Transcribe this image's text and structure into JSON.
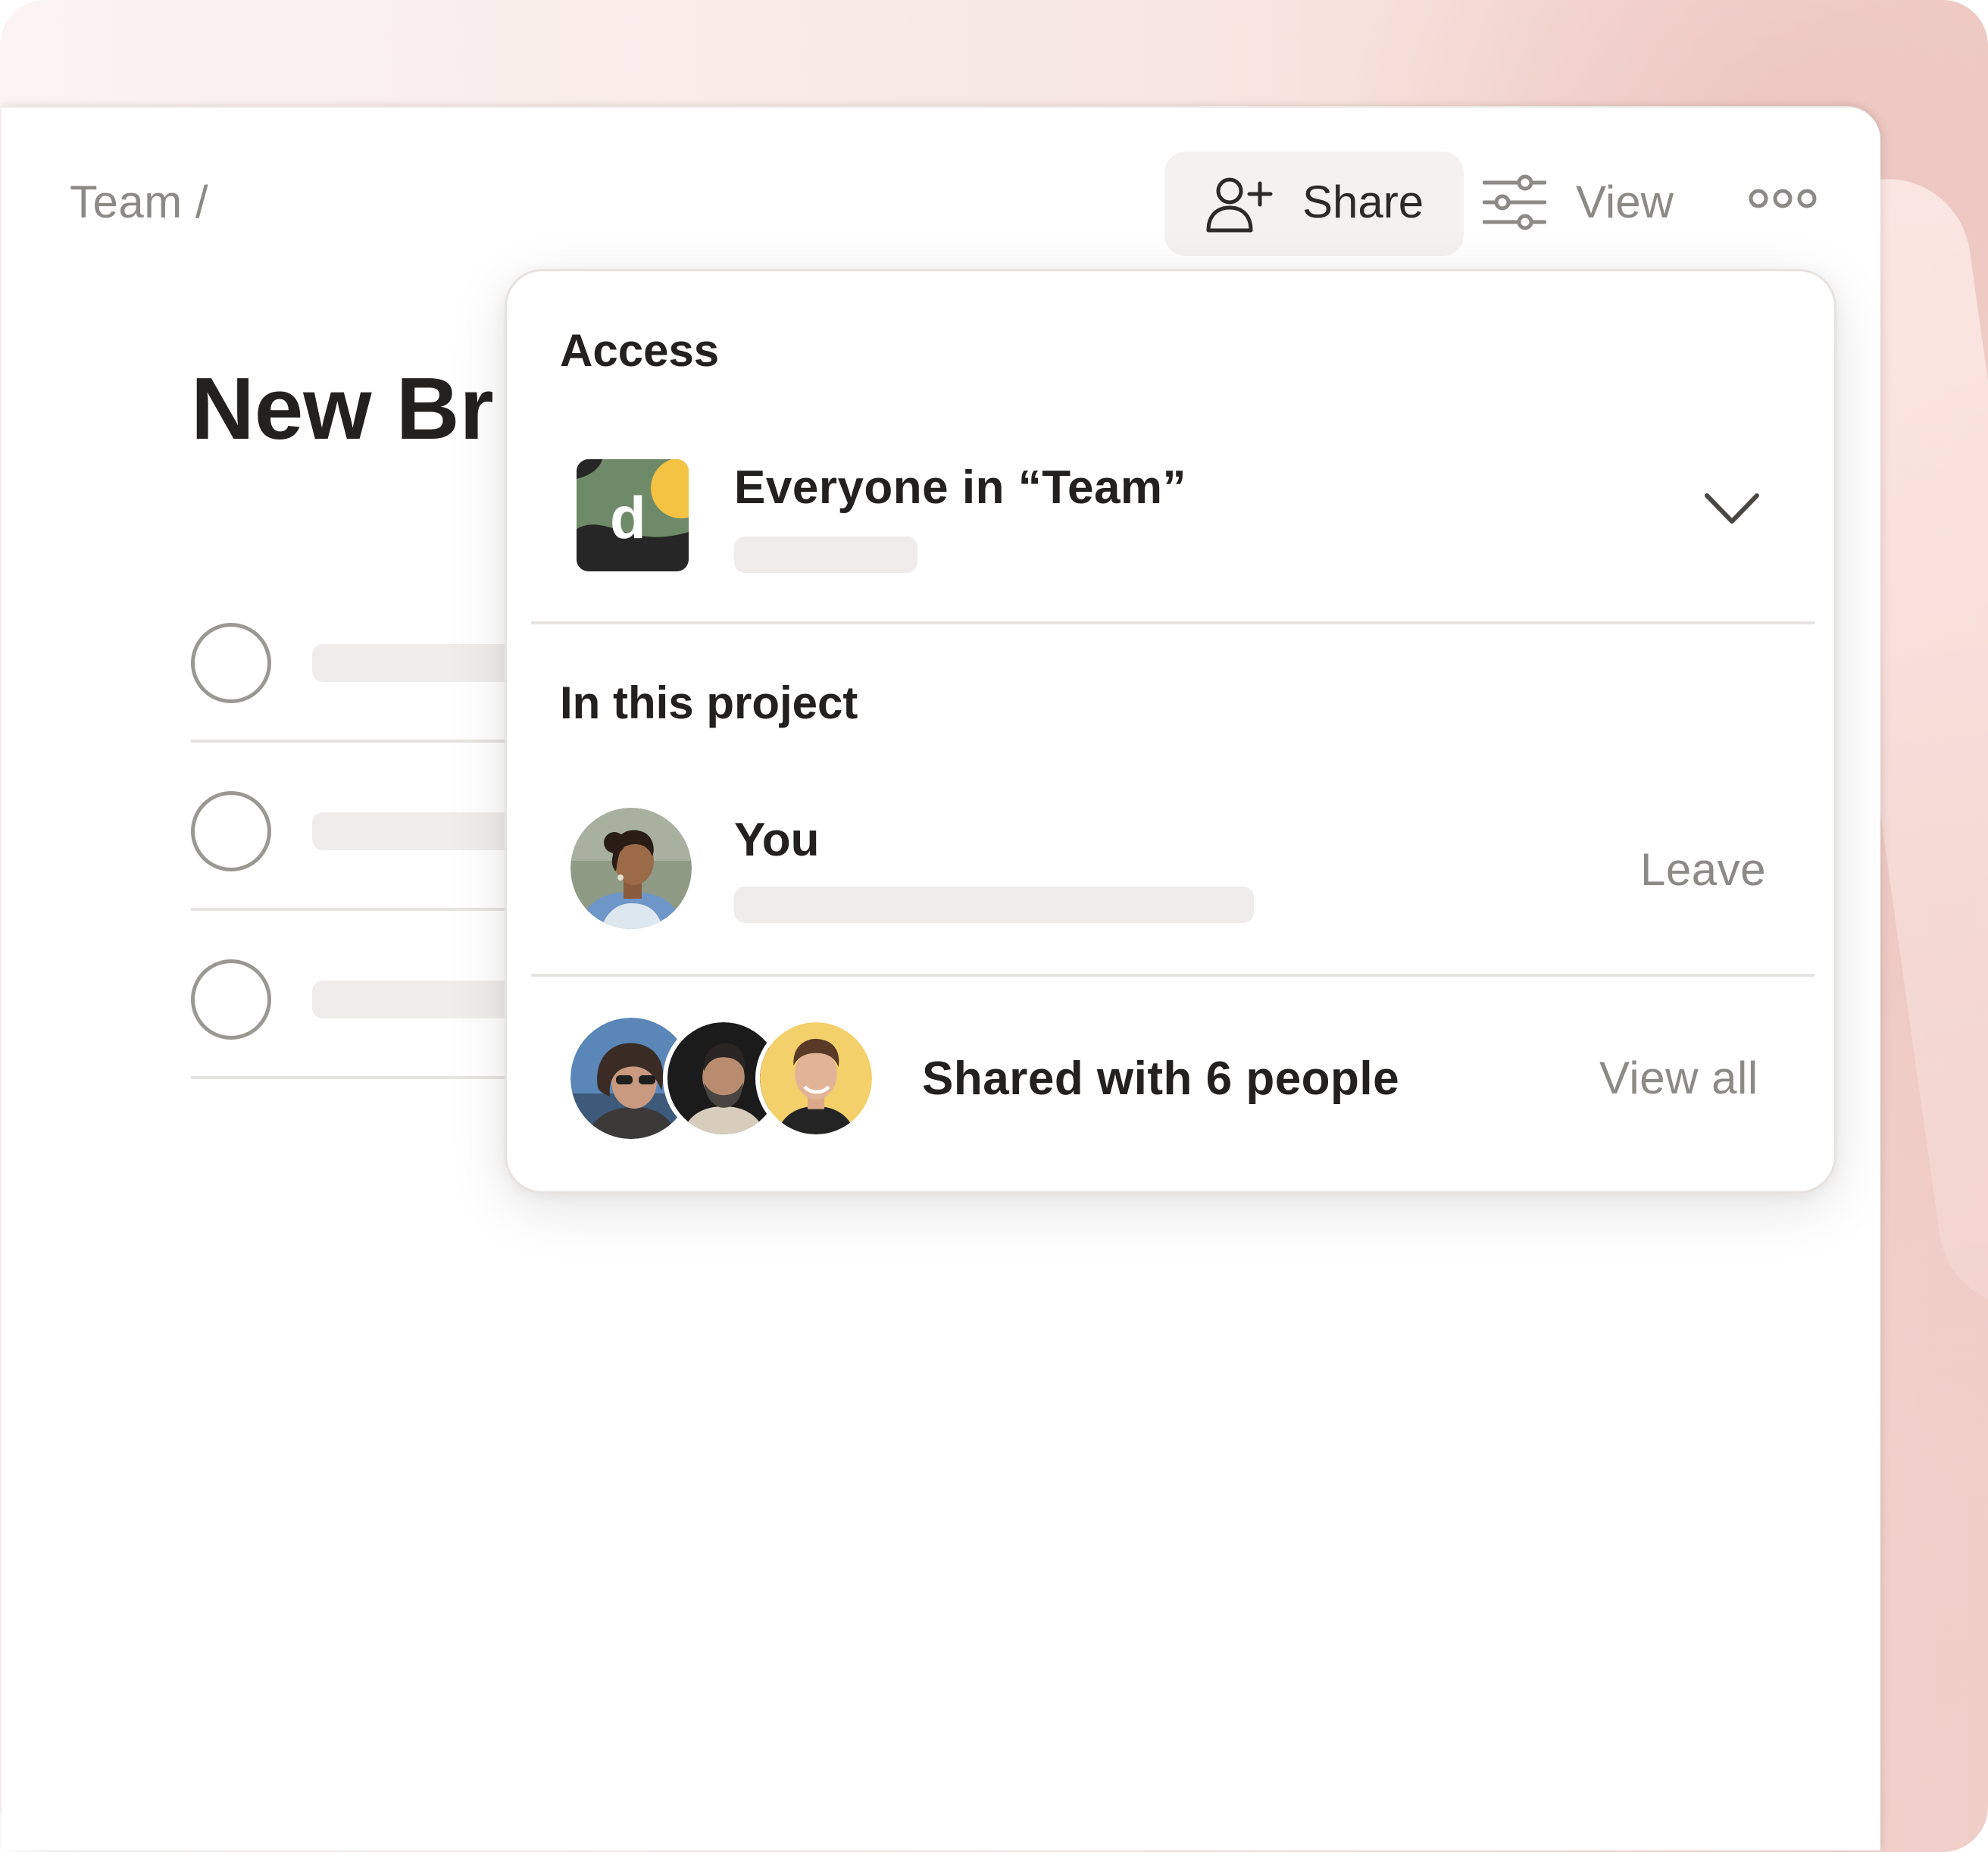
{
  "header": {
    "breadcrumb": "Team /",
    "share_label": "Share",
    "view_label": "View",
    "page_title": "New Br"
  },
  "tasks": [
    {
      "checked": false
    },
    {
      "checked": false
    },
    {
      "checked": false
    }
  ],
  "share_popover": {
    "access_heading": "Access",
    "team_access": {
      "logo_letter": "d",
      "name": "Everyone in “Team”"
    },
    "project_heading": "In this project",
    "current_user": {
      "name": "You",
      "leave_label": "Leave"
    },
    "shared_summary": {
      "text": "Shared with 6 people",
      "view_all_label": "View all"
    }
  },
  "colors": {
    "text_primary": "#23211f",
    "text_muted": "#8c8a87",
    "share_button_bg": "#f3f2f0",
    "team_logo_green": "#6f8a68",
    "team_logo_dark": "#262626",
    "team_logo_yellow": "#f5c343",
    "avatar_yellow": "#f4d06a"
  }
}
